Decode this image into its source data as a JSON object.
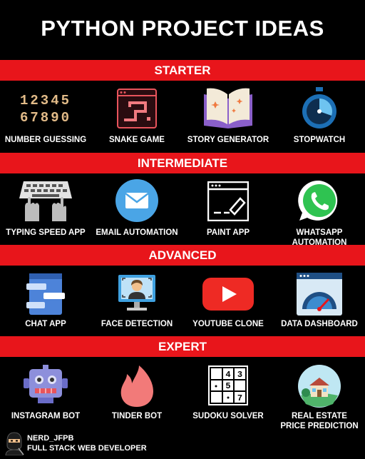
{
  "title": "PYTHON PROJECT IDEAS",
  "sections": [
    {
      "name": "STARTER",
      "items": [
        {
          "label": "NUMBER GUESSING",
          "icon": "number-digits-icon"
        },
        {
          "label": "SNAKE GAME",
          "icon": "snake-game-icon"
        },
        {
          "label": "STORY GENERATOR",
          "icon": "open-book-icon"
        },
        {
          "label": "STOPWATCH",
          "icon": "stopwatch-icon"
        }
      ]
    },
    {
      "name": "INTERMEDIATE",
      "items": [
        {
          "label": "TYPING SPEED APP",
          "icon": "keyboard-hands-icon"
        },
        {
          "label": "EMAIL AUTOMATION",
          "icon": "envelope-icon"
        },
        {
          "label": "PAINT APP",
          "icon": "paint-window-icon"
        },
        {
          "label": "WHATSAPP AUTOMATION",
          "icon": "whatsapp-icon"
        }
      ]
    },
    {
      "name": "ADVANCED",
      "items": [
        {
          "label": "CHAT APP",
          "icon": "chat-window-icon"
        },
        {
          "label": "FACE DETECTION",
          "icon": "face-scan-icon"
        },
        {
          "label": "YOUTUBE CLONE",
          "icon": "youtube-play-icon"
        },
        {
          "label": "DATA DASHBOARD",
          "icon": "gauge-dashboard-icon"
        }
      ]
    },
    {
      "name": "EXPERT",
      "items": [
        {
          "label": "INSTAGRAM BOT",
          "icon": "robot-icon"
        },
        {
          "label": "TINDER BOT",
          "icon": "flame-icon"
        },
        {
          "label": "SUDOKU SOLVER",
          "icon": "sudoku-grid-icon"
        },
        {
          "label_lines": [
            "REAL ESTATE",
            "PRICE PREDICTION"
          ],
          "icon": "house-icon"
        }
      ]
    }
  ],
  "number_icon": {
    "row1": "12345",
    "row2": "67890"
  },
  "sudoku_digits": {
    "a": "4",
    "b": "3",
    "c": "5",
    "d": "7"
  },
  "footer": {
    "handle": "NERD_JFPB",
    "role": "FULL STACK WEB DEVELOPER",
    "icon": "ninja-avatar-icon"
  },
  "colors": {
    "band": "#e8151b",
    "background": "#000000",
    "text": "#ffffff"
  }
}
